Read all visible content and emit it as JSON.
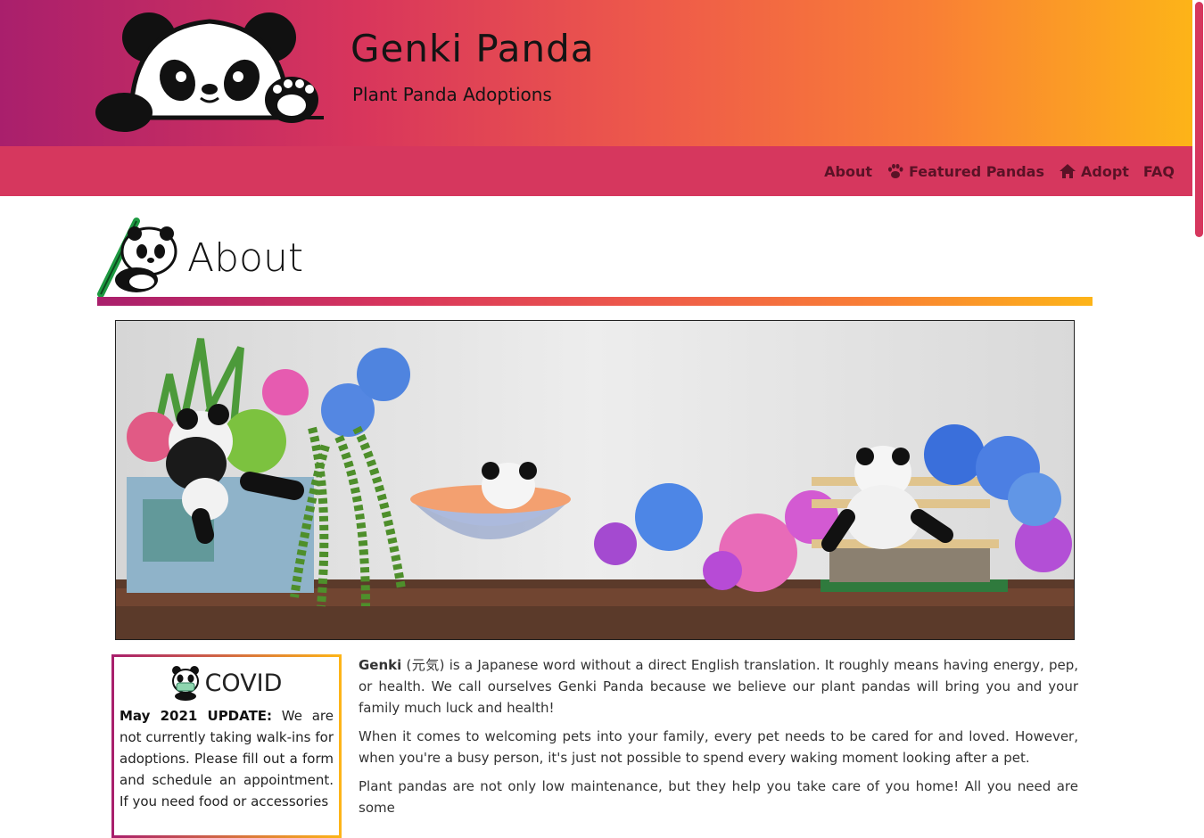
{
  "brand": {
    "title": "Genki Panda",
    "subtitle": "Plant Panda Adoptions"
  },
  "nav": {
    "items": [
      {
        "label": "About",
        "icon": ""
      },
      {
        "label": "Featured Pandas",
        "icon": "paw-icon"
      },
      {
        "label": "Adopt",
        "icon": "home-icon"
      },
      {
        "label": "FAQ",
        "icon": ""
      }
    ]
  },
  "section": {
    "title": "About"
  },
  "covid": {
    "title": "COVID",
    "update_label": "May 2021 UPDATE:",
    "update_text": " We are not currently taking walk-ins for adoptions. Please fill out a form and schedule an appointment. If you need food or accessories"
  },
  "about": {
    "p1_bold": "Genki",
    "p1_text": " (元気) is a Japanese word without a direct English translation. It roughly means having energy, pep, or health. We call ourselves Genki Panda because we believe our plant pandas will bring you and your family much luck and health!",
    "p2": "When it comes to welcoming pets into your family, every pet needs to be cared for and loved. However, when you're a busy person, it's just not possible to spend every waking moment looking after a pet.",
    "p3": "Plant pandas are not only low maintenance, but they help you take care of you home! All you need are some"
  },
  "colors": {
    "gradient_start": "#a91f6c",
    "gradient_mid": "#ee5a4a",
    "gradient_end": "#fdb418",
    "navbar": "#d6375e",
    "nav_text": "#5a1226"
  }
}
